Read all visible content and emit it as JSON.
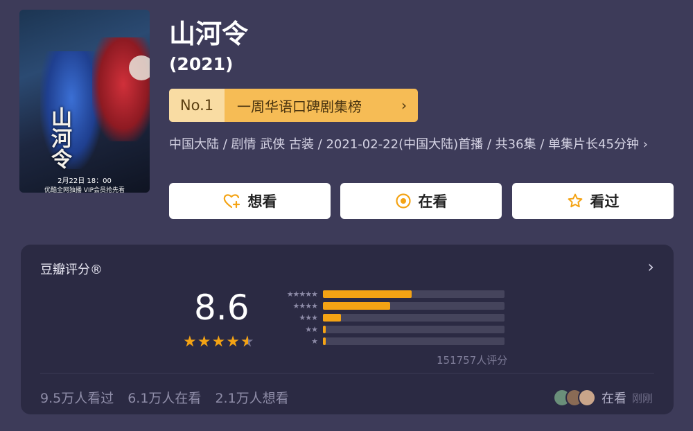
{
  "poster": {
    "calligraphy": "山河令",
    "caption_date": "2月22日 18：00",
    "caption_tagline": "优酷全网独播 VIP会员抢先看"
  },
  "header": {
    "title": "山河令",
    "year": "(2021)"
  },
  "ranking": {
    "rank": "No.1",
    "label": "一周华语口碑剧集榜",
    "chevron": "›"
  },
  "info": {
    "text": "中国大陆 / 剧情 武侠 古装 / 2021-02-22(中国大陆)首播 / 共36集 / 单集片长45分钟 ›"
  },
  "actions": {
    "want": "想看",
    "watching": "在看",
    "watched": "看过"
  },
  "rating": {
    "title": "豆瓣评分®",
    "score": "8.6",
    "stars": 4.3,
    "distribution": [
      {
        "label": "★★★★★",
        "fraction": 0.49
      },
      {
        "label": "★★★★",
        "fraction": 0.37
      },
      {
        "label": "★★★",
        "fraction": 0.1
      },
      {
        "label": "★★",
        "fraction": 0.015
      },
      {
        "label": "★",
        "fraction": 0.015
      }
    ],
    "count": "151757人评分",
    "arrow": "›"
  },
  "stats": {
    "watched": "9.5万人看过",
    "watching": "6.1万人在看",
    "want": "2.1万人想看"
  },
  "live": {
    "label": "在看",
    "time": "刚刚",
    "avatar_colors": [
      "#6a8f7a",
      "#8a6b55",
      "#c9a58a"
    ]
  },
  "colors": {
    "accent": "#f4a314",
    "background": "#3d3b59",
    "card": "#2b2a43"
  }
}
